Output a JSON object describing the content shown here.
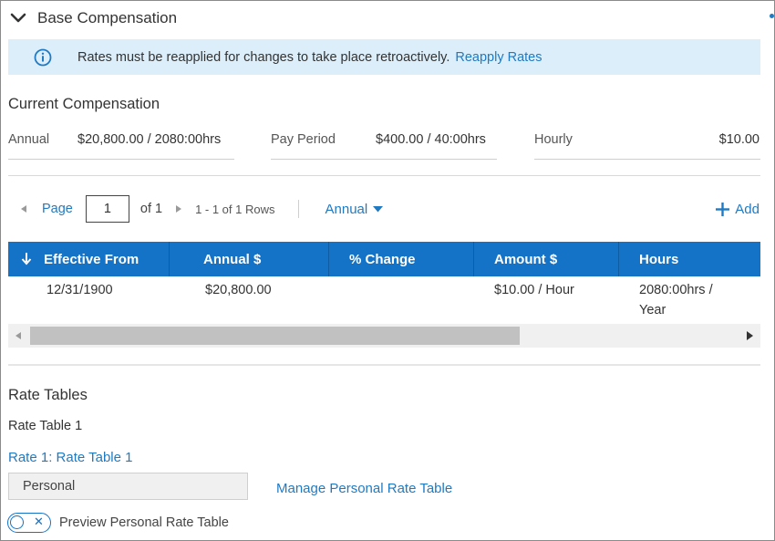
{
  "section": {
    "title": "Base Compensation"
  },
  "banner": {
    "message": "Rates must be reapplied for changes to take place retroactively.",
    "link": "Reapply Rates"
  },
  "current": {
    "heading": "Current Compensation",
    "items": [
      {
        "label": "Annual",
        "value": "$20,800.00 / 2080:00hrs"
      },
      {
        "label": "Pay Period",
        "value": "$400.00 / 40:00hrs"
      },
      {
        "label": "Hourly",
        "value": "$10.00"
      }
    ]
  },
  "pager": {
    "page_label": "Page",
    "page_value": "1",
    "of_label": "of 1",
    "rows_label": "1 - 1 of 1 Rows",
    "view": "Annual",
    "add_label": "Add"
  },
  "table": {
    "columns": [
      "Effective From",
      "Annual $",
      "% Change",
      "Amount $",
      "Hours"
    ],
    "rows": [
      {
        "effective_from": "12/31/1900",
        "annual": "$20,800.00",
        "change": "",
        "amount": "$10.00 / Hour",
        "hours_line1": "2080:00hrs /",
        "hours_line2": "Year"
      }
    ]
  },
  "rate_tables": {
    "heading": "Rate Tables",
    "name": "Rate Table 1",
    "rate_link": "Rate 1: Rate Table 1",
    "select_value": "Personal",
    "manage_link": "Manage Personal Rate Table",
    "preview_label": "Preview Personal Rate Table",
    "preview_enabled": false
  },
  "colors": {
    "accent": "#1473c7",
    "link": "#1f7ac3",
    "banner_bg": "#dbeefa"
  }
}
